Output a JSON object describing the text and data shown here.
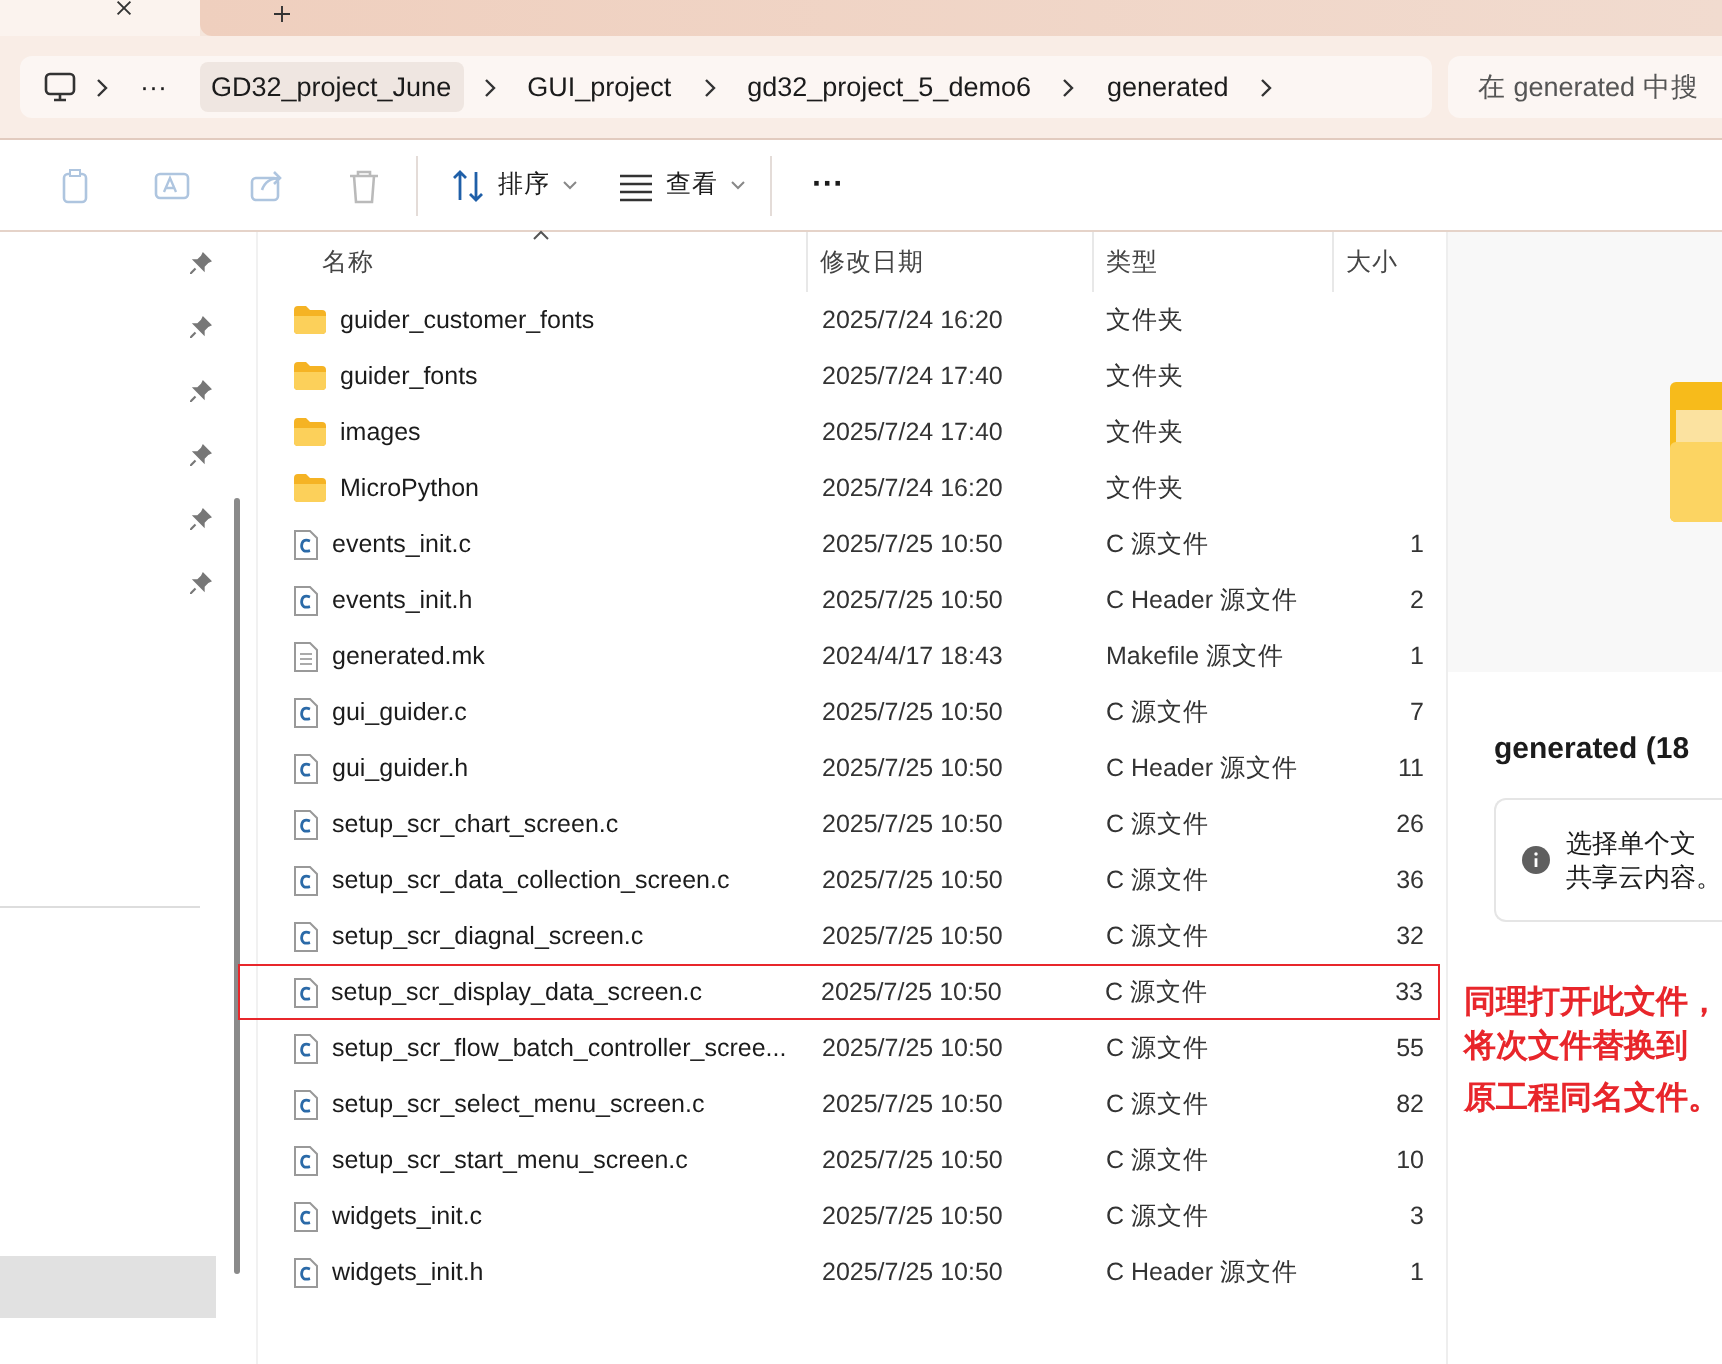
{
  "breadcrumbs": [
    {
      "label": "GD32_project_June",
      "selected": true
    },
    {
      "label": "GUI_project",
      "selected": false
    },
    {
      "label": "gd32_project_5_demo6",
      "selected": false
    },
    {
      "label": "generated",
      "selected": false
    }
  ],
  "more_path": "···",
  "search": {
    "placeholder": "在 generated 中搜"
  },
  "toolbar": [
    {
      "kind": "copy",
      "disabled": true
    },
    {
      "kind": "rename",
      "disabled": true
    },
    {
      "kind": "share",
      "disabled": true
    },
    {
      "kind": "delete",
      "disabled": true
    },
    {
      "kind": "sort",
      "label": "排序",
      "disabled": false
    },
    {
      "kind": "view",
      "label": "查看",
      "disabled": false
    },
    {
      "kind": "more",
      "label": "···",
      "disabled": false
    }
  ],
  "columns": [
    {
      "label": "名称",
      "sorted": true
    },
    {
      "label": "修改日期",
      "sorted": false
    },
    {
      "label": "类型",
      "sorted": false
    },
    {
      "label": "大小",
      "sorted": false
    }
  ],
  "files": [
    {
      "kind": "folder",
      "name": "guider_customer_fonts",
      "date": "2025/7/24 16:20",
      "type": "文件夹",
      "highlighted": false
    },
    {
      "kind": "folder",
      "name": "guider_fonts",
      "date": "2025/7/24 17:40",
      "type": "文件夹",
      "highlighted": false
    },
    {
      "kind": "folder",
      "name": "images",
      "date": "2025/7/24 17:40",
      "type": "文件夹",
      "highlighted": false
    },
    {
      "kind": "folder",
      "name": "MicroPython",
      "date": "2025/7/24 16:20",
      "type": "文件夹",
      "highlighted": false
    },
    {
      "kind": "c",
      "name": "events_init.c",
      "date": "2025/7/25 10:50",
      "type": "C 源文件",
      "size": "1",
      "highlighted": false
    },
    {
      "kind": "c",
      "name": "events_init.h",
      "date": "2025/7/25 10:50",
      "type": "C Header 源文件",
      "size": "2",
      "highlighted": false
    },
    {
      "kind": "text",
      "name": "generated.mk",
      "date": "2024/4/17 18:43",
      "type": "Makefile 源文件",
      "size": "1",
      "highlighted": false
    },
    {
      "kind": "c",
      "name": "gui_guider.c",
      "date": "2025/7/25 10:50",
      "type": "C 源文件",
      "size": "7",
      "highlighted": false
    },
    {
      "kind": "c",
      "name": "gui_guider.h",
      "date": "2025/7/25 10:50",
      "type": "C Header 源文件",
      "size": "11",
      "highlighted": false
    },
    {
      "kind": "c",
      "name": "setup_scr_chart_screen.c",
      "date": "2025/7/25 10:50",
      "type": "C 源文件",
      "size": "26",
      "highlighted": false
    },
    {
      "kind": "c",
      "name": "setup_scr_data_collection_screen.c",
      "date": "2025/7/25 10:50",
      "type": "C 源文件",
      "size": "36",
      "highlighted": false
    },
    {
      "kind": "c",
      "name": "setup_scr_diagnal_screen.c",
      "date": "2025/7/25 10:50",
      "type": "C 源文件",
      "size": "32",
      "highlighted": false
    },
    {
      "kind": "c",
      "name": "setup_scr_display_data_screen.c",
      "date": "2025/7/25 10:50",
      "type": "C 源文件",
      "size": "33",
      "highlighted": true
    },
    {
      "kind": "c",
      "name": "setup_scr_flow_batch_controller_scree...",
      "date": "2025/7/25 10:50",
      "type": "C 源文件",
      "size": "55",
      "highlighted": false
    },
    {
      "kind": "c",
      "name": "setup_scr_select_menu_screen.c",
      "date": "2025/7/25 10:50",
      "type": "C 源文件",
      "size": "82",
      "highlighted": false
    },
    {
      "kind": "c",
      "name": "setup_scr_start_menu_screen.c",
      "date": "2025/7/25 10:50",
      "type": "C 源文件",
      "size": "10",
      "highlighted": false
    },
    {
      "kind": "c",
      "name": "widgets_init.c",
      "date": "2025/7/25 10:50",
      "type": "C 源文件",
      "size": "3",
      "highlighted": false
    },
    {
      "kind": "c",
      "name": "widgets_init.h",
      "date": "2025/7/25 10:50",
      "type": "C Header 源文件",
      "size": "1",
      "highlighted": false
    }
  ],
  "details": {
    "title": "generated (18",
    "info": [
      "选择单个文",
      "共享云内容。"
    ]
  },
  "annotation": [
    "同理打开此文件，将次文件替换到",
    "原工程同名文件。"
  ]
}
